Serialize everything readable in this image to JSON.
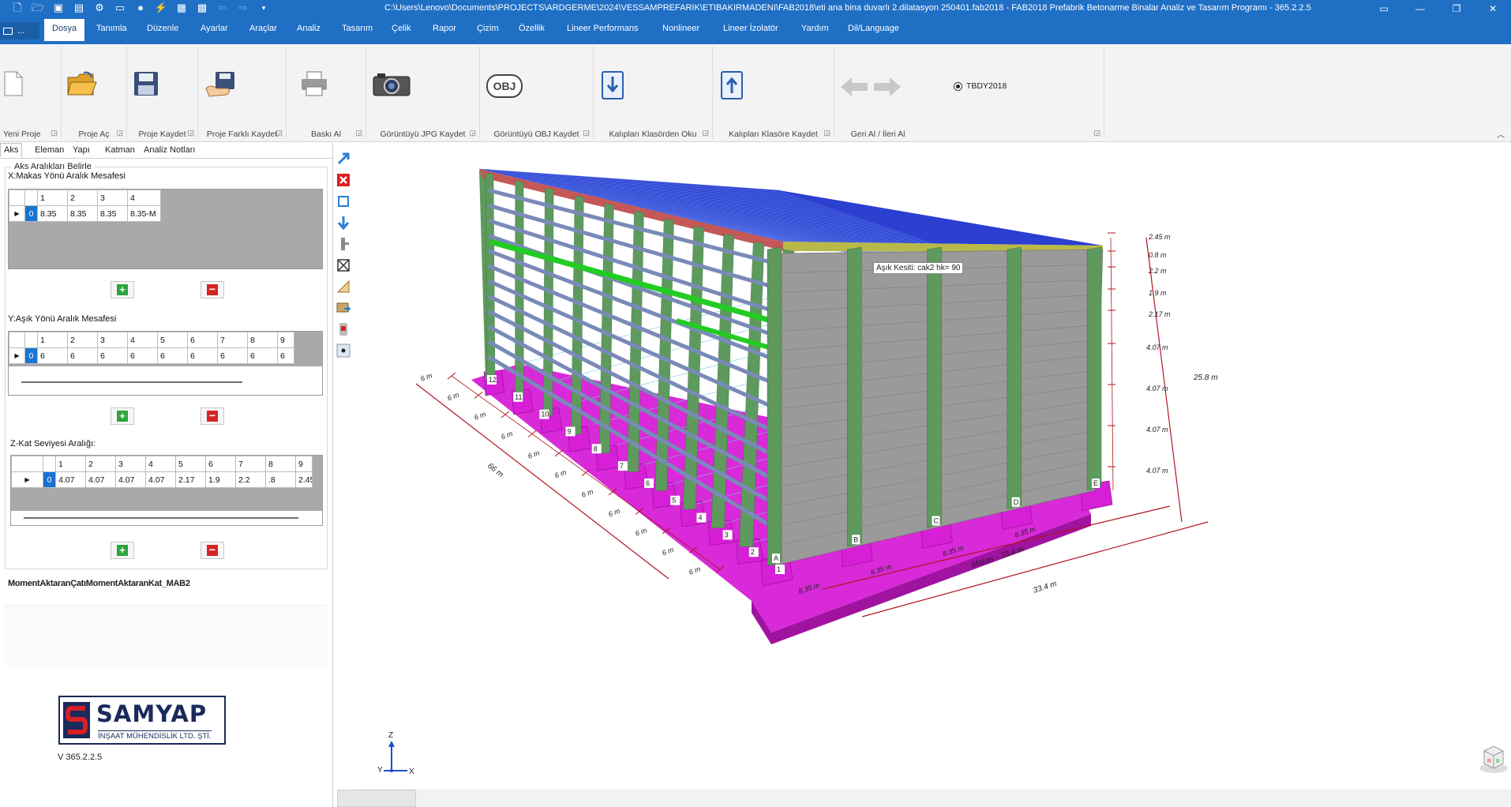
{
  "titlebar": {
    "title": "C:\\Users\\Lenovo\\Documents\\PROJECTS\\ARDGERME\\2024\\VESSAMPREFARIK\\ETIBAKIRMADENI\\FAB2018\\eti  ana bina duvarlı 2.dilatasyon 250401.fab2018 - FAB2018 Prefabrik Betonarme Binalar Analiz ve Tasarım Programı - 365.2.2.5",
    "qat_icons": [
      "new-icon",
      "open-icon",
      "save-icon",
      "save-as-icon",
      "settings-icon",
      "window-icon",
      "globe-icon",
      "bolt-icon",
      "calc-icon",
      "grid-icon",
      "undo-icon",
      "redo-icon",
      "dropdown-icon"
    ]
  },
  "menu": {
    "file_label": "...",
    "tabs": [
      "Dosya",
      "Tanımla",
      "Düzenle",
      "Ayarlar",
      "Araçlar",
      "Analiz",
      "Tasarım",
      "Çelik",
      "Rapor",
      "Çizim",
      "Özellik",
      "Lineer  Performans",
      "Nonlineer",
      "Lineer İzolatör",
      "Yardım",
      "Dil/Language"
    ],
    "active_tab": "Dosya"
  },
  "ribbon": {
    "groups": [
      {
        "label": "Yeni Proje",
        "icon": "new-file-icon"
      },
      {
        "label": "Proje Aç",
        "icon": "open-folder-icon"
      },
      {
        "label": "Proje Kaydet",
        "icon": "floppy-icon"
      },
      {
        "label": "Proje Farklı Kaydet",
        "icon": "save-as-icon"
      },
      {
        "label": "Baskı Al",
        "icon": "printer-icon"
      },
      {
        "label": "Görüntüyü JPG Kaydet",
        "icon": "camera-icon"
      },
      {
        "label": "Görüntüyü OBJ Kaydet",
        "icon": "obj-icon"
      },
      {
        "label": "Kalıpları Klasörden Oku",
        "icon": "download-icon"
      },
      {
        "label": "Kalıpları Klasöre Kaydet",
        "icon": "upload-icon"
      },
      {
        "label": "Geri Al / İleri Al",
        "icon": "undo-redo-icon"
      }
    ],
    "obj_text": "OBJ",
    "radio_label": "TBDY2018"
  },
  "panel": {
    "tabs": [
      "Aks",
      "Eleman",
      "Yapı",
      "Katman",
      "Analiz Notları"
    ],
    "active_tab": "Aks",
    "group_title": "Aks Aralıkları Belirle",
    "x_label": "X:Makas Yönü Aralık Mesafesi",
    "x_headers": [
      "1",
      "2",
      "3",
      "4"
    ],
    "x_row_index": "0",
    "x_values": [
      "8.35",
      "8.35",
      "8.35",
      "8.35-M"
    ],
    "y_label": "Y:Aşık Yönü Aralık Mesafesi",
    "y_headers": [
      "1",
      "2",
      "3",
      "4",
      "5",
      "6",
      "7",
      "8",
      "9"
    ],
    "y_row_index": "0",
    "y_values": [
      "6",
      "6",
      "6",
      "6",
      "6",
      "6",
      "6",
      "6",
      "6"
    ],
    "z_label": "Z-Kat Seviyesi Aralığı:",
    "z_headers": [
      "1",
      "2",
      "3",
      "4",
      "5",
      "6",
      "7",
      "8",
      "9"
    ],
    "z_row_index": "0",
    "z_values": [
      "4.07",
      "4.07",
      "4.07",
      "4.07",
      "2.17",
      "1.9",
      "2.2",
      ".8",
      "2.45"
    ],
    "add_symbol": "+",
    "delete_symbol": "−",
    "project_name": "MomentAktaranÇatıMomentAktaranKat_MAB2"
  },
  "logo": {
    "name": "SAMYAP",
    "subtitle": "İNŞAAT MÜHENDİSLİK LTD. ŞTİ.",
    "version": "V 365.2.2.5"
  },
  "viewport": {
    "tooltip": "Aşık Kesiti: cak2 hk= 90",
    "axis_z": "Z",
    "axis_y": "Y",
    "axis_x": "X",
    "dim_y_total": "66 m",
    "dim_y_span": "6 m",
    "dim_x_total": "33.4 m",
    "dim_x_makas": "Makas - 33.4 m",
    "dim_x_span": "8.35 m",
    "dim_z_total": "25.8 m",
    "z_levels": [
      "2.45 m",
      "0.8 m",
      "2.2 m",
      "1.9 m",
      "2.17 m",
      "4.07 m",
      "4.07 m",
      "4.07 m",
      "4.07 m"
    ],
    "y_axis_labels": [
      "1",
      "2",
      "3",
      "4",
      "5",
      "6",
      "7",
      "8",
      "9",
      "10",
      "11",
      "12"
    ],
    "x_axis_labels": [
      "A",
      "B",
      "C",
      "D",
      "E"
    ],
    "colors": {
      "column": "#5e9a5e",
      "foundation": "#d61fd6",
      "wall": "#9a9a9a",
      "beam": "#c45858",
      "roof": "#2b3fd0",
      "purlin": "#7a8ab8",
      "dimension": "#b0141e",
      "green_beam": "#22cc22"
    }
  }
}
